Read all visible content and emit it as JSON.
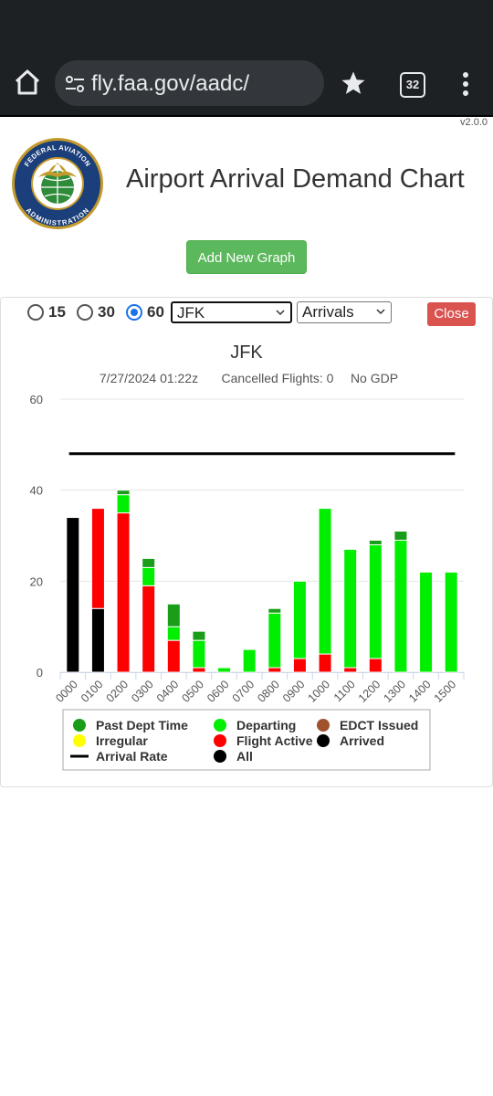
{
  "browser": {
    "url": "fly.faa.gov/aadc/",
    "tab_count": "32"
  },
  "app": {
    "version": "v2.0.0",
    "title": "Airport Arrival Demand Chart",
    "logo_text_top": "FEDERAL AVIATION",
    "logo_text_bottom": "ADMINISTRATION",
    "add_graph_label": "Add New Graph"
  },
  "controls": {
    "intervals": [
      {
        "label": "15",
        "checked": false
      },
      {
        "label": "30",
        "checked": false
      },
      {
        "label": "60",
        "checked": true
      }
    ],
    "airport": "JFK",
    "mode": "Arrivals",
    "close_label": "Close"
  },
  "colors": {
    "past_dept_time": "#1a9e1a",
    "departing": "#00ee00",
    "edct_issued": "#a0522d",
    "irregular": "#ffff00",
    "flight_active": "#ff0000",
    "arrived": "#000000",
    "arrival_rate": "#000000",
    "all": "#000000",
    "gridline": "#e5e5e5",
    "add_button": "#5cb85c",
    "close_button": "#d9534f"
  },
  "chart_data": {
    "type": "bar",
    "stacked": true,
    "title": "JFK",
    "subtitle_date": "7/27/2024 01:22z",
    "subtitle_cancelled": "Cancelled Flights: 0",
    "subtitle_gdp": "No GDP",
    "categories": [
      "0000",
      "0100",
      "0200",
      "0300",
      "0400",
      "0500",
      "0600",
      "0700",
      "0800",
      "0900",
      "1000",
      "1100",
      "1200",
      "1300",
      "1400",
      "1500"
    ],
    "ylim": [
      0,
      60
    ],
    "yticks": [
      0,
      20,
      40,
      60
    ],
    "grid": true,
    "series": [
      {
        "name": "Arrived",
        "key": "arrived",
        "values": [
          34,
          14,
          0,
          0,
          0,
          0,
          0,
          0,
          0,
          0,
          0,
          0,
          0,
          0,
          0,
          0
        ]
      },
      {
        "name": "Flight Active",
        "key": "flight_active",
        "values": [
          0,
          22,
          35,
          19,
          7,
          1,
          0,
          0,
          1,
          3,
          4,
          1,
          3,
          0,
          0,
          0
        ]
      },
      {
        "name": "Irregular",
        "key": "irregular",
        "values": [
          0,
          0,
          0,
          0,
          0,
          0,
          0,
          0,
          0,
          0,
          0,
          0,
          0,
          0,
          0,
          0
        ]
      },
      {
        "name": "EDCT Issued",
        "key": "edct_issued",
        "values": [
          0,
          0,
          0,
          0,
          0,
          0,
          0,
          0,
          0,
          0,
          0,
          0,
          0,
          0,
          0,
          0
        ]
      },
      {
        "name": "Departing",
        "key": "departing",
        "values": [
          0,
          0,
          4,
          4,
          3,
          6,
          1,
          5,
          12,
          17,
          32,
          26,
          25,
          29,
          22,
          22
        ]
      },
      {
        "name": "Past Dept Time",
        "key": "past_dept_time",
        "values": [
          0,
          0,
          1,
          2,
          5,
          2,
          0,
          0,
          1,
          0,
          0,
          0,
          1,
          2,
          0,
          0
        ]
      }
    ],
    "arrival_rate": {
      "name": "Arrival Rate",
      "value": 48
    },
    "legend": [
      {
        "label": "Past Dept Time",
        "key": "past_dept_time",
        "shape": "dot"
      },
      {
        "label": "Departing",
        "key": "departing",
        "shape": "dot"
      },
      {
        "label": "EDCT Issued",
        "key": "edct_issued",
        "shape": "dot"
      },
      {
        "label": "Irregular",
        "key": "irregular",
        "shape": "dot"
      },
      {
        "label": "Flight Active",
        "key": "flight_active",
        "shape": "dot"
      },
      {
        "label": "Arrived",
        "key": "arrived",
        "shape": "dot"
      },
      {
        "label": "Arrival Rate",
        "key": "arrival_rate",
        "shape": "line"
      },
      {
        "label": "All",
        "key": "all",
        "shape": "dot"
      }
    ],
    "legend_placement": "bottom"
  }
}
